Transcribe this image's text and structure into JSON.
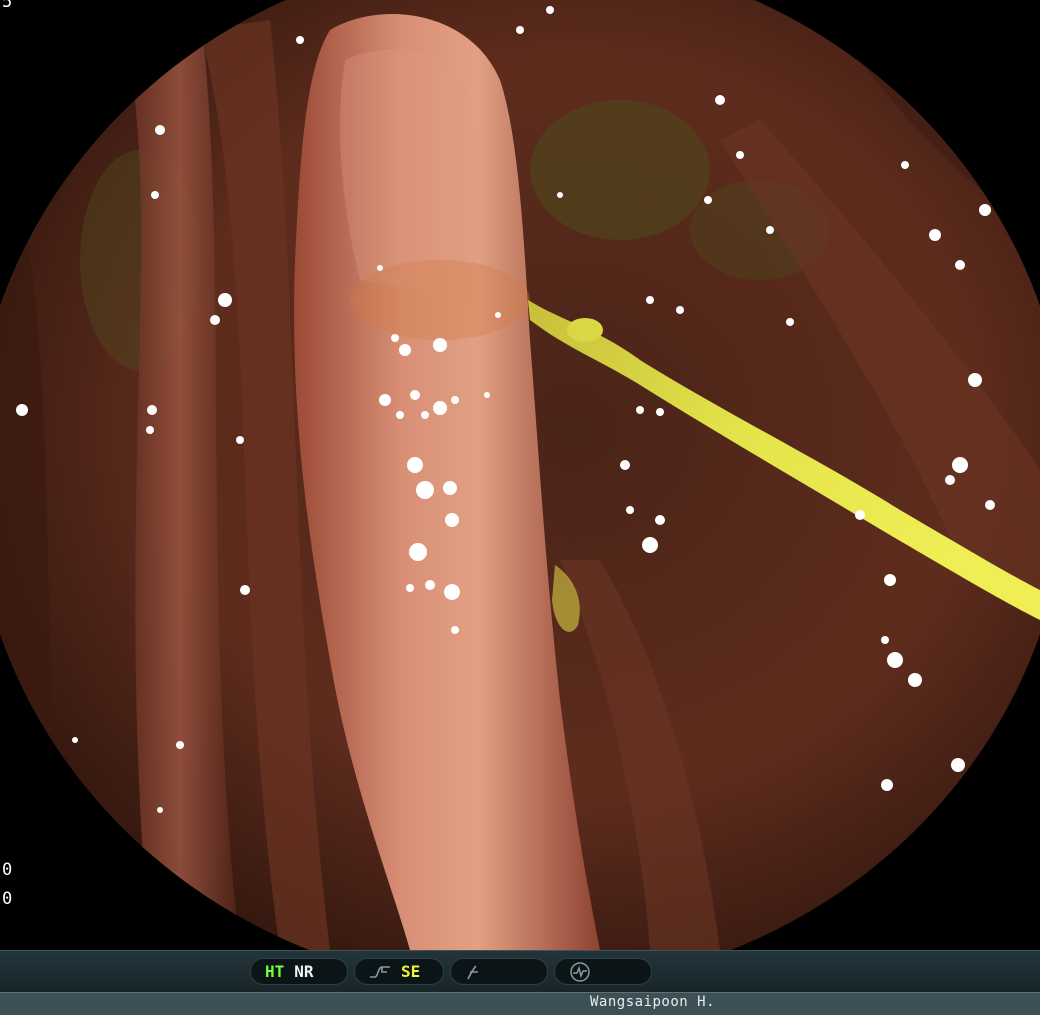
{
  "overlay": {
    "corner_top": "5",
    "corner_low_1": "0",
    "corner_low_2": "0"
  },
  "status_bar": {
    "ht_label": "HT",
    "nr_label": "NR",
    "se_label": "SE",
    "icons": [
      "tone-curve-icon",
      "structure-enhance-icon",
      "waveform-icon"
    ]
  },
  "info_bar": {
    "operator": "Wangsaipoon H."
  },
  "colors": {
    "ht": "#6fff3c",
    "nr": "#eef3f2",
    "se": "#f2f23a",
    "mucosa": "#8a3f2e",
    "bile_line": "#d6d83a"
  }
}
